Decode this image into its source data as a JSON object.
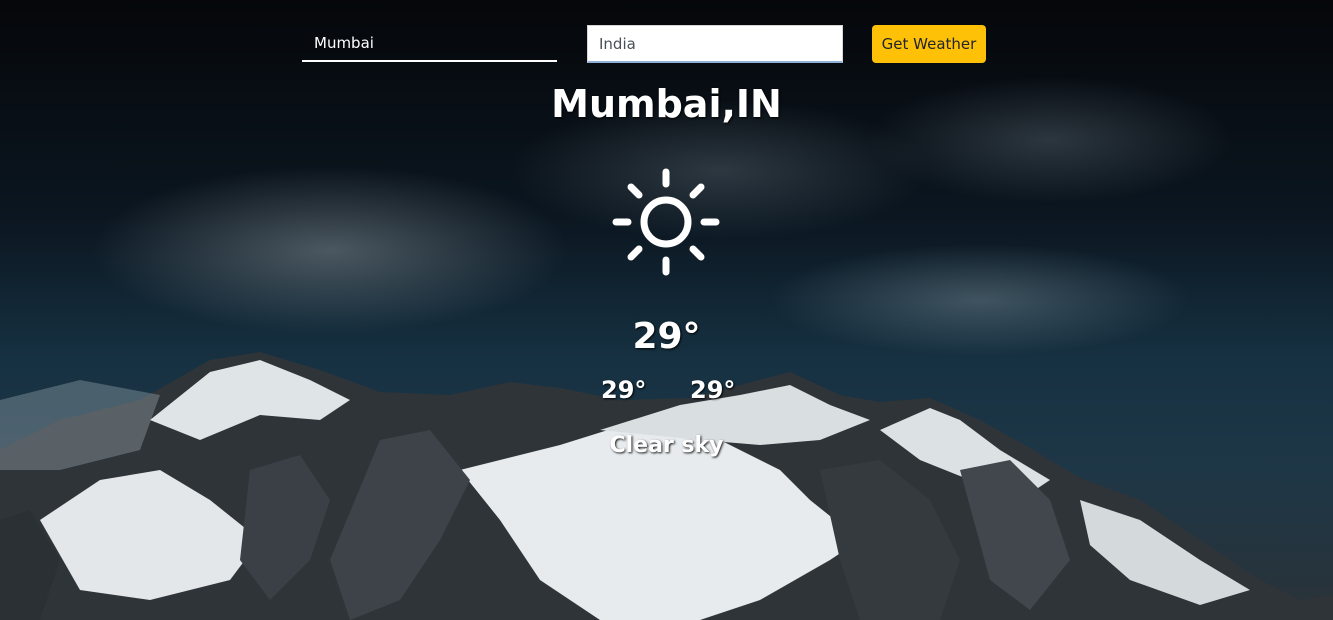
{
  "search": {
    "city_value": "Mumbai",
    "country_value": "India",
    "button_label": "Get Weather"
  },
  "weather": {
    "location": "Mumbai,IN",
    "icon": "sun-icon",
    "temperature": "29°",
    "temp_min": "29°",
    "temp_max": "29°",
    "description": "Clear sky"
  },
  "colors": {
    "button": "#ffc107",
    "text": "#ffffff",
    "sky_dark": "#05070a",
    "snow": "#e8ecee",
    "rock": "#3a3f44"
  },
  "background": "snowy-mountain-with-clouds"
}
